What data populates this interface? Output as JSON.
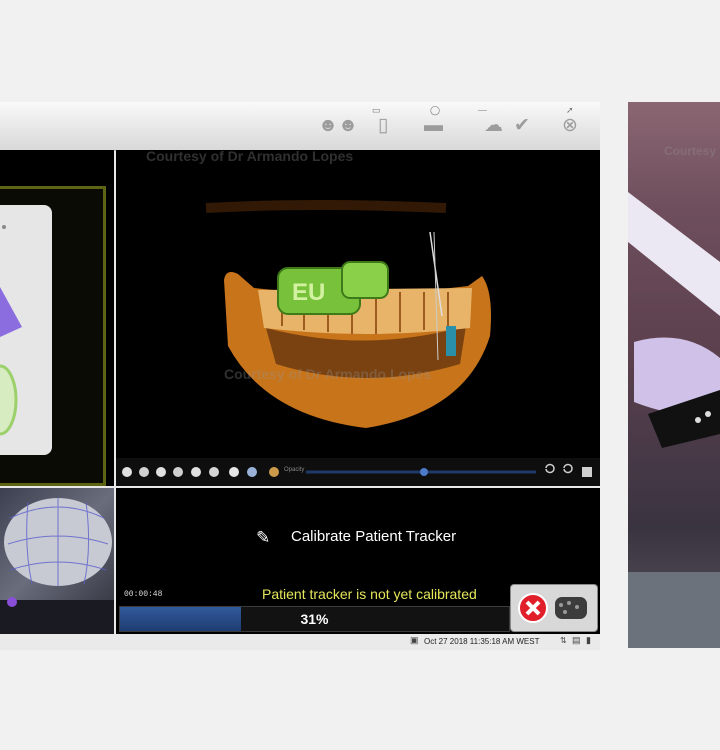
{
  "app": {
    "watermark": "Courtesy of Dr Armando Lopes",
    "toolbar_icons": [
      "users-icon",
      "tracker-icon",
      "jaw-view-icon",
      "arch-view-icon",
      "instrument-icon",
      "close-circle-icon"
    ],
    "opacity_label": "Opacity"
  },
  "calibration": {
    "title": "Calibrate Patient Tracker",
    "status": "Patient tracker is not yet calibrated",
    "timer": "00:00:48",
    "progress_percent": 31,
    "progress_text": "31%"
  },
  "statusbar": {
    "datetime": "Oct 27 2018 11:35:18 AM WEST"
  },
  "colors": {
    "accent_yellow": "#e4e75a",
    "progress_blue": "#2a4a85",
    "guide_green": "#77c23a",
    "bone_orange": "#c8741a"
  }
}
